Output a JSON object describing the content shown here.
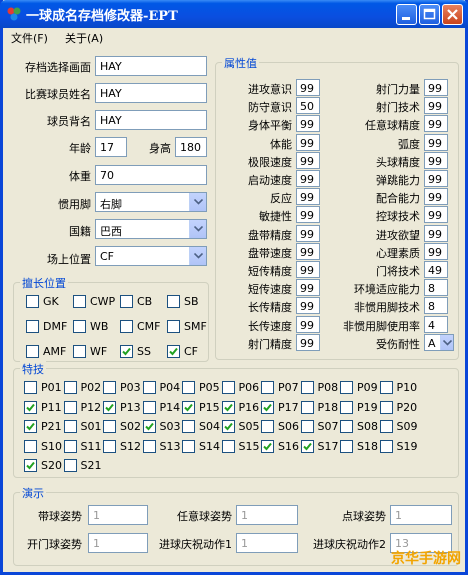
{
  "window": {
    "title": "一球成名存档修改器-EPT"
  },
  "menu": {
    "file": "文件(F)",
    "about": "关于(A)"
  },
  "left": {
    "save_select_label": "存档选择画面",
    "save_select_value": "HAY",
    "player_name_label": "比赛球员姓名",
    "player_name_value": "HAY",
    "back_name_label": "球员背名",
    "back_name_value": "HAY",
    "age_label": "年龄",
    "age_value": "17",
    "height_label": "身高",
    "height_value": "180",
    "weight_label": "体重",
    "weight_value": "70",
    "foot_label": "惯用脚",
    "foot_value": "右脚",
    "nation_label": "国籍",
    "nation_value": "巴西",
    "position_label": "场上位置",
    "position_value": "CF"
  },
  "positions": {
    "title": "擅长位置",
    "items": [
      {
        "label": "GK",
        "checked": false
      },
      {
        "label": "CWP",
        "checked": false
      },
      {
        "label": "CB",
        "checked": false
      },
      {
        "label": "SB",
        "checked": false
      },
      {
        "label": "DMF",
        "checked": false
      },
      {
        "label": "WB",
        "checked": false
      },
      {
        "label": "CMF",
        "checked": false
      },
      {
        "label": "SMF",
        "checked": false
      },
      {
        "label": "AMF",
        "checked": false
      },
      {
        "label": "WF",
        "checked": false
      },
      {
        "label": "SS",
        "checked": true
      },
      {
        "label": "CF",
        "checked": true
      }
    ]
  },
  "attributes": {
    "title": "属性值",
    "left": [
      {
        "label": "进攻意识",
        "value": "99"
      },
      {
        "label": "防守意识",
        "value": "50"
      },
      {
        "label": "身体平衡",
        "value": "99"
      },
      {
        "label": "体能",
        "value": "99"
      },
      {
        "label": "极限速度",
        "value": "99"
      },
      {
        "label": "启动速度",
        "value": "99"
      },
      {
        "label": "反应",
        "value": "99"
      },
      {
        "label": "敏捷性",
        "value": "99"
      },
      {
        "label": "盘带精度",
        "value": "99"
      },
      {
        "label": "盘带速度",
        "value": "99"
      },
      {
        "label": "短传精度",
        "value": "99"
      },
      {
        "label": "短传速度",
        "value": "99"
      },
      {
        "label": "长传精度",
        "value": "99"
      },
      {
        "label": "长传速度",
        "value": "99"
      },
      {
        "label": "射门精度",
        "value": "99"
      }
    ],
    "right": [
      {
        "label": "射门力量",
        "value": "99"
      },
      {
        "label": "射门技术",
        "value": "99"
      },
      {
        "label": "任意球精度",
        "value": "99"
      },
      {
        "label": "弧度",
        "value": "99"
      },
      {
        "label": "头球精度",
        "value": "99"
      },
      {
        "label": "弹跳能力",
        "value": "99"
      },
      {
        "label": "配合能力",
        "value": "99"
      },
      {
        "label": "控球技术",
        "value": "99"
      },
      {
        "label": "进攻欲望",
        "value": "99"
      },
      {
        "label": "心理素质",
        "value": "99"
      },
      {
        "label": "门将技术",
        "value": "49"
      },
      {
        "label": "环境适应能力",
        "value": "8"
      },
      {
        "label": "非惯用脚技术",
        "value": "8"
      },
      {
        "label": "非惯用脚使用率",
        "value": "4"
      },
      {
        "label": "受伤耐性",
        "value": "A"
      }
    ]
  },
  "skills": {
    "title": "特技",
    "items": [
      {
        "label": "P01",
        "checked": false
      },
      {
        "label": "P02",
        "checked": false
      },
      {
        "label": "P03",
        "checked": false
      },
      {
        "label": "P04",
        "checked": false
      },
      {
        "label": "P05",
        "checked": false
      },
      {
        "label": "P06",
        "checked": false
      },
      {
        "label": "P07",
        "checked": false
      },
      {
        "label": "P08",
        "checked": false
      },
      {
        "label": "P09",
        "checked": false
      },
      {
        "label": "P10",
        "checked": false
      },
      {
        "label": "P11",
        "checked": true
      },
      {
        "label": "P12",
        "checked": false
      },
      {
        "label": "P13",
        "checked": true
      },
      {
        "label": "P14",
        "checked": false
      },
      {
        "label": "P15",
        "checked": true
      },
      {
        "label": "P16",
        "checked": true
      },
      {
        "label": "P17",
        "checked": true
      },
      {
        "label": "P18",
        "checked": false
      },
      {
        "label": "P19",
        "checked": false
      },
      {
        "label": "P20",
        "checked": false
      },
      {
        "label": "P21",
        "checked": true
      },
      {
        "label": "S01",
        "checked": false
      },
      {
        "label": "S02",
        "checked": false
      },
      {
        "label": "S03",
        "checked": true
      },
      {
        "label": "S04",
        "checked": false
      },
      {
        "label": "S05",
        "checked": true
      },
      {
        "label": "S06",
        "checked": false
      },
      {
        "label": "S07",
        "checked": false
      },
      {
        "label": "S08",
        "checked": false
      },
      {
        "label": "S09",
        "checked": false
      },
      {
        "label": "S10",
        "checked": false
      },
      {
        "label": "S11",
        "checked": false
      },
      {
        "label": "S12",
        "checked": false
      },
      {
        "label": "S13",
        "checked": false
      },
      {
        "label": "S14",
        "checked": false
      },
      {
        "label": "S15",
        "checked": false
      },
      {
        "label": "S16",
        "checked": true
      },
      {
        "label": "S17",
        "checked": true
      },
      {
        "label": "S18",
        "checked": false
      },
      {
        "label": "S19",
        "checked": false
      },
      {
        "label": "S20",
        "checked": true
      },
      {
        "label": "S21",
        "checked": false
      }
    ]
  },
  "performance": {
    "title": "演示",
    "dribble_label": "带球姿势",
    "dribble_value": "1",
    "freekick_label": "任意球姿势",
    "freekick_value": "1",
    "penalty_label": "点球姿势",
    "penalty_value": "1",
    "goalkick_label": "开门球姿势",
    "goalkick_value": "1",
    "celebrate1_label": "进球庆祝动作1",
    "celebrate1_value": "1",
    "celebrate2_label": "进球庆祝动作2",
    "celebrate2_value": "13"
  },
  "watermark": "京华手游网"
}
